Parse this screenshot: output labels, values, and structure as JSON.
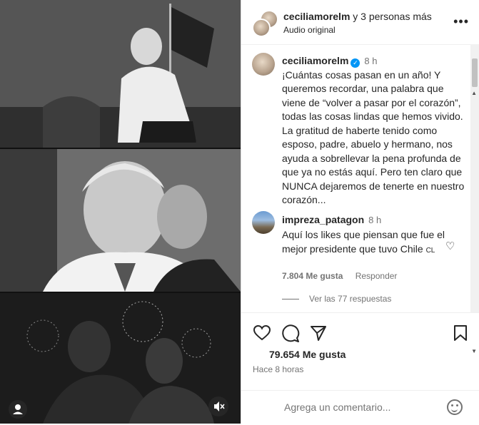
{
  "header": {
    "username": "ceciliamorelm",
    "collab_suffix": "y 3 personas más",
    "audio": "Audio original",
    "more_icon": "more-horizontal-icon"
  },
  "caption": {
    "username": "ceciliamorelm",
    "verified": true,
    "time": "8 h",
    "text": "¡Cuántas cosas pasan en un año! Y queremos recordar, una palabra que viene de “volver a pasar por el corazón”, todas las cosas lindas que hemos vivido. La gratitud de haberte tenido como esposo, padre, abuelo y hermano, nos ayuda a sobrellevar la pena profunda de que ya no estás aquí. Pero ten claro que NUNCA dejaremos de tenerte en nuestro corazón..."
  },
  "comment": {
    "username": "impreza_patagon",
    "time": "8 h",
    "text": "Aquí los likes que piensan que fue el mejor presidente que tuvo Chile",
    "flag_text": "CL",
    "likes": "7.804 Me gusta",
    "reply_label": "Responder",
    "view_replies": "Ver las 77 respuestas"
  },
  "post": {
    "likes": "79.654 Me gusta",
    "time_ago": "Hace 8 horas"
  },
  "composer": {
    "placeholder": "Agrega un comentario..."
  },
  "colors": {
    "accent": "#0095f6",
    "text": "#262626",
    "muted": "#737373"
  }
}
